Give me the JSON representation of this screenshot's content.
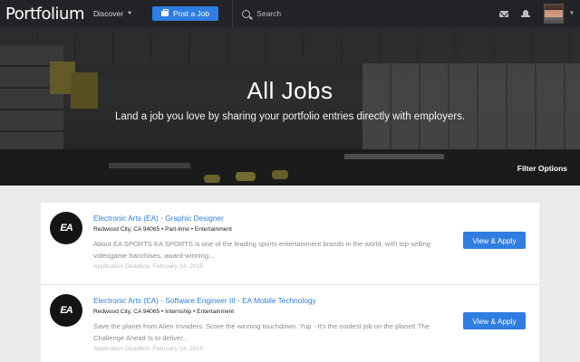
{
  "nav": {
    "logo": "Portfolium",
    "discover_label": "Discover",
    "post_job_label": "Post a Job",
    "search_placeholder": "Search"
  },
  "hero": {
    "title": "All Jobs",
    "subtitle": "Land a job you love by sharing your portfolio entries directly with employers.",
    "filter_label": "Filter Options"
  },
  "jobs": [
    {
      "logo_text": "EA",
      "title": "Electronic Arts (EA) - Graphic Designer",
      "meta": "Redwood City, CA 94065 • Part-time • Entertainment",
      "description": "About EA SPORTS EA SPORTS is one of the leading sports entertainment brands in the world, with top-selling videogame franchises, award-winning...",
      "deadline": "Application Deadline: February 14, 2015",
      "apply_label": "View & Apply"
    },
    {
      "logo_text": "EA",
      "title": "Electronic Arts (EA) - Software Engineer III - EA Mobile Technology",
      "meta": "Redwood City, CA 94065 • Internship • Entertainment",
      "description": "Save the planet from Alien Invaders. Score the winning touchdown. Yup - It's the coolest job on the planet! The Challenge Ahead Is to deliver...",
      "deadline": "Application Deadline: February 14, 2015",
      "apply_label": "View & Apply"
    }
  ],
  "colors": {
    "nav_bg": "#222326",
    "accent": "#2f7de1",
    "page_bg": "#ebebeb"
  }
}
